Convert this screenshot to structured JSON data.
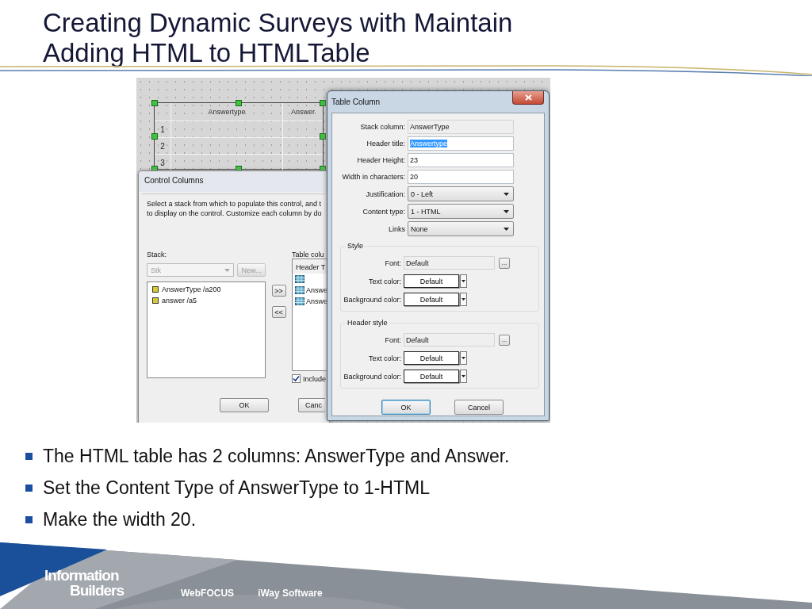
{
  "slide": {
    "title_lines": [
      "Creating Dynamic Surveys with Maintain",
      "Adding HTML to HTMLTable"
    ]
  },
  "screenshot": {
    "design_table": {
      "columns": [
        "Answertype",
        "Answer"
      ],
      "row_numbers": [
        "1",
        "2",
        "3"
      ]
    },
    "control_columns": {
      "title": "Control Columns",
      "description_lines": [
        "Select a stack from which to populate this control, and t",
        "to display on the control.  Customize each column by do"
      ],
      "stack_label": "Stack:",
      "stack_select": {
        "value": "Stk",
        "disabled": true
      },
      "new_button": {
        "label": "New...",
        "disabled": true
      },
      "stack_items": [
        "AnswerType /a200",
        "answer /a5"
      ],
      "add_button": ">>",
      "remove_button": "<<",
      "table_columns_label": "Table colu",
      "table_header": "Header T",
      "table_items": [
        {
          "kind": "icon"
        },
        {
          "kind": "labeled",
          "label": "Answe"
        },
        {
          "kind": "labeled",
          "label": "Answe"
        }
      ],
      "include_checkbox": {
        "label": "Include",
        "checked": true
      },
      "ok_button": "OK",
      "cancel_button": "Canc"
    },
    "table_column": {
      "title": "Table Column",
      "fields": [
        {
          "kind": "readonly",
          "label": "Stack column:",
          "value": "AnswerType",
          "highlighted": false
        },
        {
          "kind": "text",
          "label": "Header title:",
          "value": "Answertype",
          "highlighted": true
        },
        {
          "kind": "text",
          "label": "Header Height:",
          "value": "23",
          "highlighted": false
        },
        {
          "kind": "text",
          "label": "Width in characters:",
          "value": "20",
          "highlighted": false
        },
        {
          "kind": "select",
          "label": "Justification:",
          "value": "0 - Left",
          "highlighted": false
        },
        {
          "kind": "select",
          "label": "Content type:",
          "value": "1 - HTML",
          "highlighted": false
        },
        {
          "kind": "select",
          "label": "Links",
          "value": "None",
          "highlighted": false
        }
      ],
      "groups": [
        {
          "title": "Style",
          "rows": [
            {
              "kind": "font",
              "label": "Font:",
              "value": "Default",
              "button": "..."
            },
            {
              "kind": "color",
              "label": "Text color:",
              "value": "Default"
            },
            {
              "kind": "color",
              "label": "Background color:",
              "value": "Default"
            }
          ]
        },
        {
          "title": "Header style",
          "rows": [
            {
              "kind": "font",
              "label": "Font:",
              "value": "Default",
              "button": "..."
            },
            {
              "kind": "color",
              "label": "Text color:",
              "value": "Default"
            },
            {
              "kind": "color",
              "label": "Background color:",
              "value": "Default"
            }
          ]
        }
      ],
      "buttons": [
        {
          "label": "OK",
          "default": true
        },
        {
          "label": "Cancel",
          "default": false
        }
      ]
    }
  },
  "bullets": [
    "The HTML table has 2 columns: AnswerType and Answer.",
    "Set the Content Type of AnswerType to 1-HTML",
    "Make the width 20."
  ],
  "footer": {
    "logo_lines": [
      "Information",
      "Builders"
    ],
    "links": [
      "WebFOCUS",
      "iWay Software"
    ]
  }
}
